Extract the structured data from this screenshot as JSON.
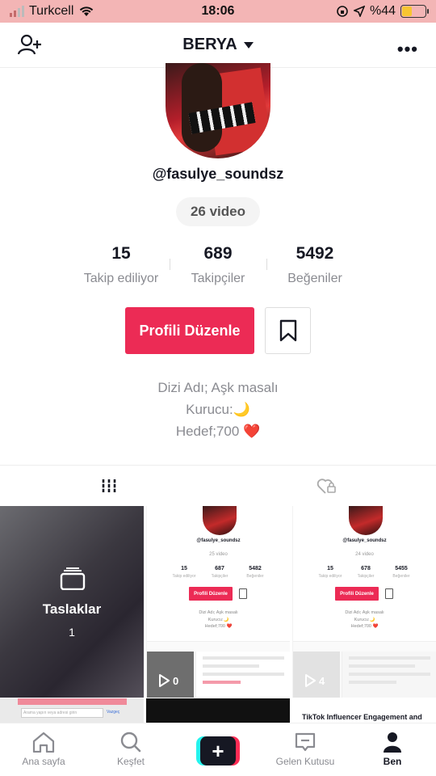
{
  "status": {
    "carrier": "Turkcell",
    "time": "18:06",
    "battery": "%44",
    "battery_level": 0.44
  },
  "header": {
    "title": "BERYA"
  },
  "profile": {
    "handle": "@fasulye_soundsz",
    "video_count": "26 video",
    "stats": [
      {
        "num": "15",
        "label": "Takip ediliyor"
      },
      {
        "num": "689",
        "label": "Takipçiler"
      },
      {
        "num": "5492",
        "label": "Beğeniler"
      }
    ],
    "edit_label": "Profili Düzenle",
    "bio": [
      "Dizi Adı; Aşk masalı",
      "Kurucu:🌙",
      "Hedef;700 ❤️"
    ]
  },
  "drafts": {
    "label": "Taslaklar",
    "count": "1"
  },
  "thumbs": [
    {
      "handle": "@fasulye_soundsz",
      "videos": "25 video",
      "stats": [
        {
          "n": "15",
          "l": "Takip ediliyor"
        },
        {
          "n": "687",
          "l": "Takipçiler"
        },
        {
          "n": "5482",
          "l": "Beğeniler"
        }
      ],
      "edit": "Profili Düzenle",
      "bio": [
        "Dizi Adı; Aşk masalı",
        "Kurucu:🌙",
        "Hedef;700 ❤️"
      ],
      "play_count": "0"
    },
    {
      "handle": "@fasulye_soundsz",
      "videos": "24 video",
      "stats": [
        {
          "n": "15",
          "l": "Takip ediliyor"
        },
        {
          "n": "678",
          "l": "Takipçiler"
        },
        {
          "n": "5455",
          "l": "Beğeniler"
        }
      ],
      "edit": "Profili Düzenle",
      "bio": [
        "Dizi Adı; Aşk masalı",
        "Kurucu:🌙",
        "Hedef;700 ❤️"
      ],
      "play_count": "4"
    }
  ],
  "row2": {
    "search_placeholder": "Arama yapın veya adresi girin",
    "link": "Vazgeç",
    "article_title": "TikTok Influencer Engagement and Earnings Calculator"
  },
  "nav": [
    {
      "label": "Ana sayfa"
    },
    {
      "label": "Keşfet"
    },
    {
      "label": "+"
    },
    {
      "label": "Gelen Kutusu"
    },
    {
      "label": "Ben"
    }
  ]
}
